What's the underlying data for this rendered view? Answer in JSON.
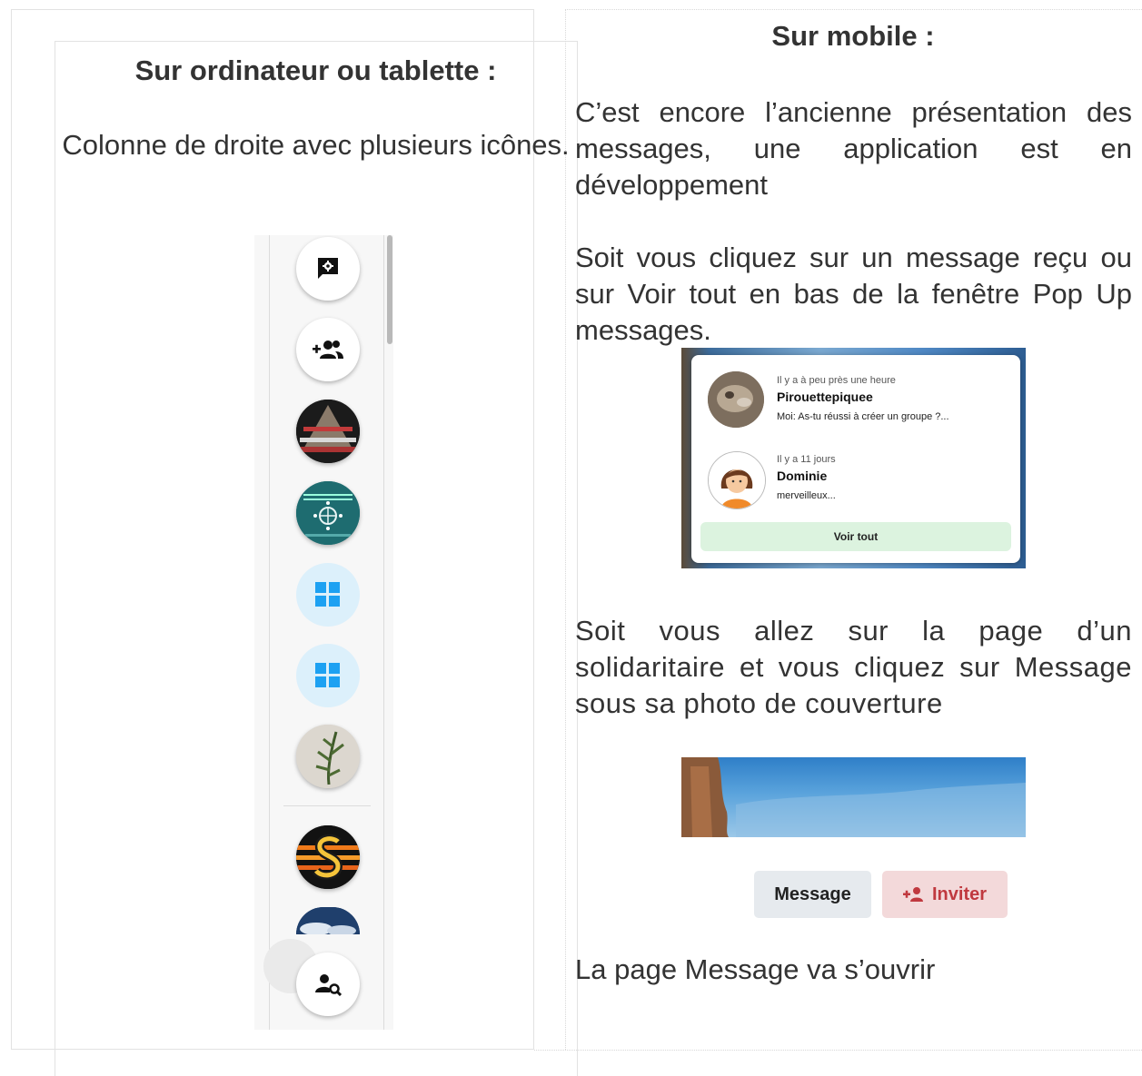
{
  "left": {
    "title": "Sur ordinateur ou tablette :",
    "description": "Colonne de droite avec plusieurs icônes.",
    "sidebar_icons": [
      "message-settings-icon",
      "add-group-icon",
      "group-avatar-pyramid",
      "group-avatar-globe",
      "apps-grid-icon",
      "apps-grid-icon",
      "group-avatar-plant",
      "group-avatar-logo-s",
      "group-avatar-sky",
      "find-person-icon"
    ]
  },
  "right": {
    "title": "Sur mobile :",
    "para1": "C’est encore l’ancienne présentation des messages, une application est en développement",
    "para2": "Soit vous cliquez sur un message reçu ou sur Voir tout en bas de la fenêtre Pop Up messages.",
    "popup": {
      "messages": [
        {
          "time": "Il y a à peu près une heure",
          "name": "Pirouettepiquee",
          "text": "Moi: As-tu réussi à créer un groupe ?..."
        },
        {
          "time": "Il y a 11 jours",
          "name": "Dominie",
          "text": "merveilleux..."
        }
      ],
      "see_all": "Voir tout"
    },
    "para3": "Soit vous allez sur la page d’un solidaritaire et vous cliquez sur Message sous sa photo de couverture",
    "buttons": {
      "message": "Message",
      "invite": "Inviter"
    },
    "para4": "La page Message va s’ouvrir",
    "colors": {
      "invite_text": "#c0393f",
      "invite_bg": "#f3d9da",
      "see_all_bg": "#dcf3df",
      "grid_icon": "#1da1f2"
    }
  }
}
